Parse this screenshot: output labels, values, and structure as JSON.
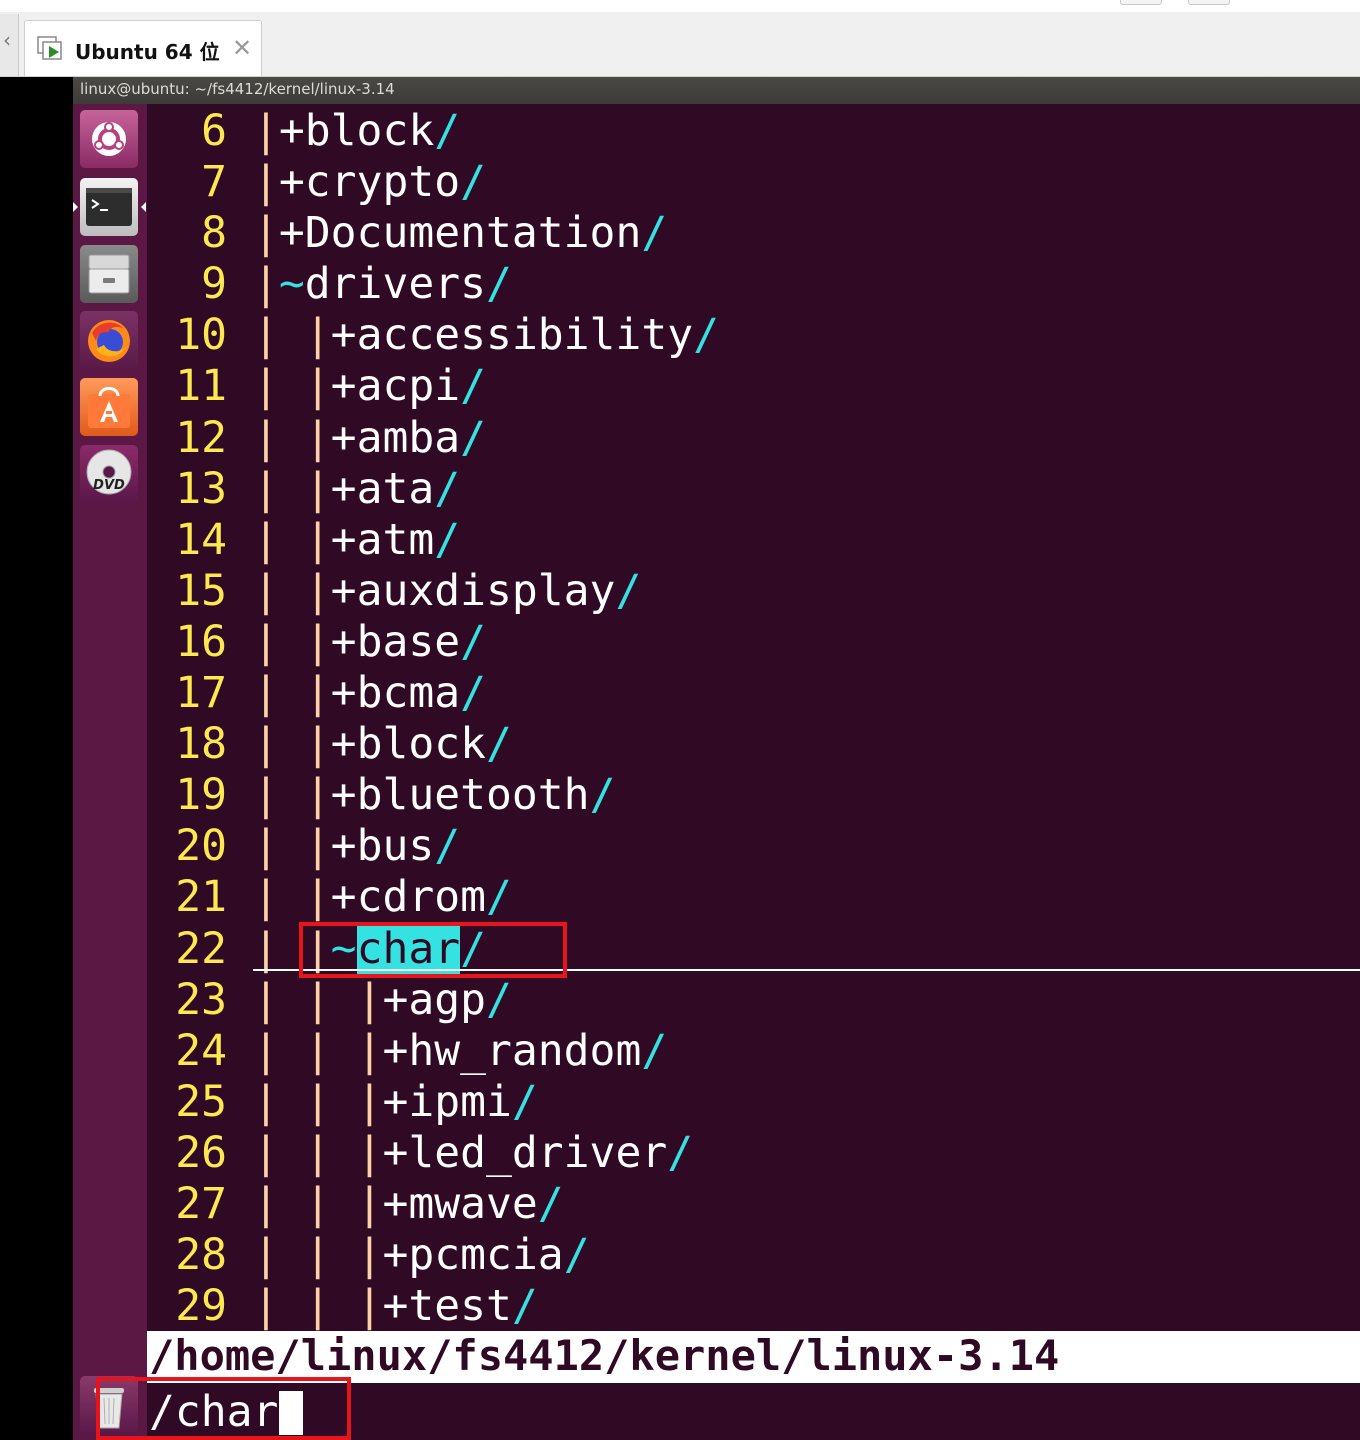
{
  "vm_tab": {
    "label": "Ubuntu 64 位",
    "close_icon": "close-icon",
    "icon": "vm-tab-icon"
  },
  "window": {
    "title": "linux@ubuntu: ~/fs4412/kernel/linux-3.14"
  },
  "launcher": {
    "items": [
      {
        "name": "ubuntu-dash-icon"
      },
      {
        "name": "terminal-icon"
      },
      {
        "name": "files-icon"
      },
      {
        "name": "firefox-icon"
      },
      {
        "name": "software-center-icon"
      },
      {
        "name": "dvd-icon"
      },
      {
        "name": "trash-icon"
      }
    ]
  },
  "colors": {
    "terminal_bg": "#300a24",
    "line_number": "#fce94f",
    "dir_slash": "#34e2e2",
    "tree_pipe": "#fbd3a6",
    "launcher_bg": "#5b1845",
    "highlight_box": "#e8141c"
  },
  "tree": {
    "lines": [
      {
        "num": "6",
        "indent": "|",
        "sign": "+",
        "name": "block",
        "slash": "/"
      },
      {
        "num": "7",
        "indent": "|",
        "sign": "+",
        "name": "crypto",
        "slash": "/"
      },
      {
        "num": "8",
        "indent": "|",
        "sign": "+",
        "name": "Documentation",
        "slash": "/"
      },
      {
        "num": "9",
        "indent": "|",
        "sign": "~",
        "name": "drivers",
        "slash": "/"
      },
      {
        "num": "10",
        "indent": "| |",
        "sign": "+",
        "name": "accessibility",
        "slash": "/"
      },
      {
        "num": "11",
        "indent": "| |",
        "sign": "+",
        "name": "acpi",
        "slash": "/"
      },
      {
        "num": "12",
        "indent": "| |",
        "sign": "+",
        "name": "amba",
        "slash": "/"
      },
      {
        "num": "13",
        "indent": "| |",
        "sign": "+",
        "name": "ata",
        "slash": "/"
      },
      {
        "num": "14",
        "indent": "| |",
        "sign": "+",
        "name": "atm",
        "slash": "/"
      },
      {
        "num": "15",
        "indent": "| |",
        "sign": "+",
        "name": "auxdisplay",
        "slash": "/"
      },
      {
        "num": "16",
        "indent": "| |",
        "sign": "+",
        "name": "base",
        "slash": "/"
      },
      {
        "num": "17",
        "indent": "| |",
        "sign": "+",
        "name": "bcma",
        "slash": "/"
      },
      {
        "num": "18",
        "indent": "| |",
        "sign": "+",
        "name": "block",
        "slash": "/"
      },
      {
        "num": "19",
        "indent": "| |",
        "sign": "+",
        "name": "bluetooth",
        "slash": "/"
      },
      {
        "num": "20",
        "indent": "| |",
        "sign": "+",
        "name": "bus",
        "slash": "/"
      },
      {
        "num": "21",
        "indent": "| |",
        "sign": "+",
        "name": "cdrom",
        "slash": "/"
      },
      {
        "num": "22",
        "indent": "| |",
        "sign": "~",
        "name": "char",
        "slash": "/",
        "highlight": true
      },
      {
        "num": "23",
        "indent": "| | |",
        "sign": "+",
        "name": "agp",
        "slash": "/"
      },
      {
        "num": "24",
        "indent": "| | |",
        "sign": "+",
        "name": "hw_random",
        "slash": "/"
      },
      {
        "num": "25",
        "indent": "| | |",
        "sign": "+",
        "name": "ipmi",
        "slash": "/"
      },
      {
        "num": "26",
        "indent": "| | |",
        "sign": "+",
        "name": "led_driver",
        "slash": "/"
      },
      {
        "num": "27",
        "indent": "| | |",
        "sign": "+",
        "name": "mwave",
        "slash": "/"
      },
      {
        "num": "28",
        "indent": "| | |",
        "sign": "+",
        "name": "pcmcia",
        "slash": "/"
      },
      {
        "num": "29",
        "indent": "| | |",
        "sign": "+",
        "name": "test",
        "slash": "/"
      }
    ]
  },
  "statusline": {
    "path": "/home/linux/fs4412/kernel/linux-3.14"
  },
  "cmdline": {
    "text": "/char"
  }
}
